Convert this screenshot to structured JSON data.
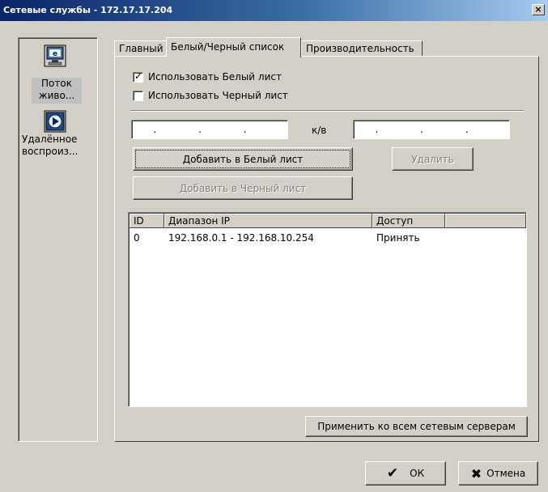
{
  "window": {
    "title": "Сетевые службы - 172.17.17.204",
    "close_label": "×"
  },
  "sidebar": {
    "items": [
      {
        "label_line1": "Поток",
        "label_line2": "живо...",
        "icon": "monitor-icon"
      },
      {
        "label_line1": "Удалённое",
        "label_line2": "воспроиз...",
        "icon": "play-icon"
      }
    ]
  },
  "tabs": [
    {
      "label": "Главный"
    },
    {
      "label": "Белый/Черный список"
    },
    {
      "label": "Производительность"
    }
  ],
  "whitelist": {
    "use_white_label": "Использовать Белый лист",
    "use_white_checked": true,
    "use_black_label": "Использовать Черный лист",
    "use_black_checked": false,
    "ip_from": ". . .",
    "range_separator": "к/в",
    "ip_to": ". . .",
    "add_white_label": "Добавить в Белый лист",
    "delete_label": "Удалить",
    "add_black_label": "Добавить в Черный лист"
  },
  "table": {
    "columns": [
      "ID",
      "Диапазон IP",
      "Доступ",
      ""
    ],
    "rows": [
      {
        "id": "0",
        "range": "192.168.0.1 - 192.168.10.254",
        "access": "Принять"
      }
    ]
  },
  "apply_all_label": "Применить ко всем сетевым серверам",
  "footer": {
    "ok_label": "ОК",
    "cancel_label": "Отмена"
  },
  "colors": {
    "face": "#d4d0c8",
    "title_start": "#0a246a",
    "title_end": "#a6caf0"
  }
}
